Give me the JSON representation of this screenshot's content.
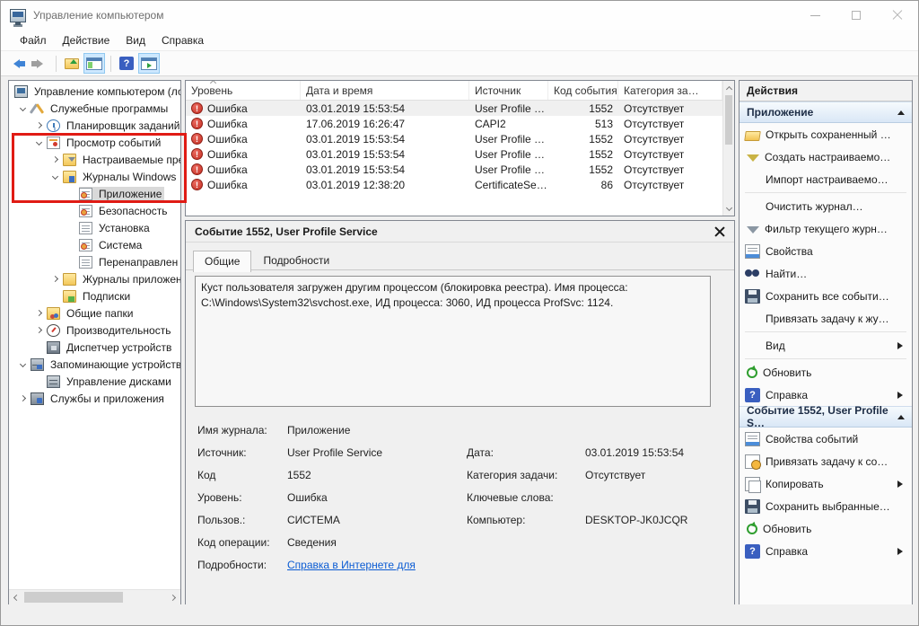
{
  "window": {
    "title": "Управление компьютером"
  },
  "menu": {
    "items": [
      "Файл",
      "Действие",
      "Вид",
      "Справка"
    ]
  },
  "tree": {
    "items": [
      {
        "label": "Управление компьютером (ло"
      },
      {
        "label": "Служебные программы"
      },
      {
        "label": "Планировщик заданий"
      },
      {
        "label": "Просмотр событий"
      },
      {
        "label": "Настраиваемые пре"
      },
      {
        "label": "Журналы Windows"
      },
      {
        "label": "Приложение"
      },
      {
        "label": "Безопасность"
      },
      {
        "label": "Установка"
      },
      {
        "label": "Система"
      },
      {
        "label": "Перенаправлен"
      },
      {
        "label": "Журналы приложен"
      },
      {
        "label": "Подписки"
      },
      {
        "label": "Общие папки"
      },
      {
        "label": "Производительность"
      },
      {
        "label": "Диспетчер устройств"
      },
      {
        "label": "Запоминающие устройств"
      },
      {
        "label": "Управление дисками"
      },
      {
        "label": "Службы и приложения"
      }
    ]
  },
  "event_list": {
    "columns": [
      "Уровень",
      "Дата и время",
      "Источник",
      "Код события",
      "Категория за…"
    ],
    "rows": [
      {
        "level": "Ошибка",
        "datetime": "03.01.2019 15:53:54",
        "source": "User Profile …",
        "code": "1552",
        "category": "Отсутствует"
      },
      {
        "level": "Ошибка",
        "datetime": "17.06.2019 16:26:47",
        "source": "CAPI2",
        "code": "513",
        "category": "Отсутствует"
      },
      {
        "level": "Ошибка",
        "datetime": "03.01.2019 15:53:54",
        "source": "User Profile …",
        "code": "1552",
        "category": "Отсутствует"
      },
      {
        "level": "Ошибка",
        "datetime": "03.01.2019 15:53:54",
        "source": "User Profile …",
        "code": "1552",
        "category": "Отсутствует"
      },
      {
        "level": "Ошибка",
        "datetime": "03.01.2019 15:53:54",
        "source": "User Profile …",
        "code": "1552",
        "category": "Отсутствует"
      },
      {
        "level": "Ошибка",
        "datetime": "03.01.2019 12:38:20",
        "source": "CertificateSe…",
        "code": "86",
        "category": "Отсутствует"
      }
    ]
  },
  "detail": {
    "title": "Событие 1552, User Profile Service",
    "tabs": {
      "general": "Общие",
      "details": "Подробности"
    },
    "description": "Куст пользователя загружен другим процессом (блокировка реестра). Имя процесса: C:\\Windows\\System32\\svchost.exe, ИД процесса: 3060, ИД процесса ProfSvc: 1124.",
    "fields": {
      "log_name": {
        "label": "Имя журнала:",
        "value": "Приложение"
      },
      "source": {
        "label": "Источник:",
        "value": "User Profile Service"
      },
      "code": {
        "label": "Код",
        "value": "1552"
      },
      "level": {
        "label": "Уровень:",
        "value": "Ошибка"
      },
      "user": {
        "label": "Пользов.:",
        "value": "СИСТЕМА"
      },
      "opcode": {
        "label": "Код операции:",
        "value": "Сведения"
      },
      "more": {
        "label": "Подробности:",
        "link": "Справка в Интернете для "
      },
      "date": {
        "label": "Дата:",
        "value": "03.01.2019 15:53:54"
      },
      "category": {
        "label": "Категория задачи:",
        "value": "Отсутствует"
      },
      "keywords": {
        "label": "Ключевые слова:",
        "value": ""
      },
      "computer": {
        "label": "Компьютер:",
        "value": "DESKTOP-JK0JCQR"
      }
    }
  },
  "actions": {
    "title": "Действия",
    "sections": [
      {
        "header": "Приложение",
        "items": [
          {
            "label": "Открыть сохраненный …"
          },
          {
            "label": "Создать настраиваемо…"
          },
          {
            "label": "Импорт настраиваемо…"
          },
          {
            "label": "Очистить журнал…"
          },
          {
            "label": "Фильтр текущего журн…"
          },
          {
            "label": "Свойства"
          },
          {
            "label": "Найти…"
          },
          {
            "label": "Сохранить все событи…"
          },
          {
            "label": "Привязать задачу к жу…"
          },
          {
            "label": "Вид"
          },
          {
            "label": "Обновить"
          },
          {
            "label": "Справка"
          }
        ]
      },
      {
        "header": "Событие 1552, User Profile S…",
        "items": [
          {
            "label": "Свойства событий"
          },
          {
            "label": "Привязать задачу к со…"
          },
          {
            "label": "Копировать"
          },
          {
            "label": "Сохранить выбранные…"
          },
          {
            "label": "Обновить"
          },
          {
            "label": "Справка"
          }
        ]
      }
    ]
  },
  "colors": {
    "accent_red": "#e01b14",
    "link_blue": "#0a5bd3",
    "error_red": "#c62f23"
  }
}
